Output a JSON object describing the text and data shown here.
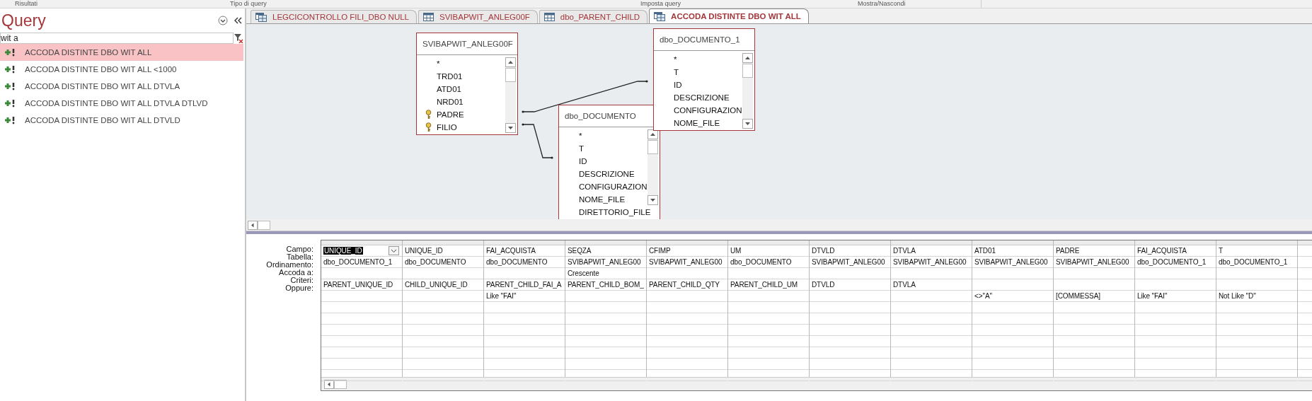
{
  "ribbon_groups": [
    "Risultati",
    "Tipo di query",
    "Imposta query",
    "Mostra/Nascondi"
  ],
  "nav_pane": {
    "title": "Query",
    "search": {
      "value": "wit a"
    },
    "items": [
      {
        "label": "ACCODA DISTINTE DBO WIT ALL",
        "selected": true
      },
      {
        "label": "ACCODA DISTINTE DBO WIT ALL <1000",
        "selected": false
      },
      {
        "label": "ACCODA DISTINTE DBO WIT ALL DTVLA",
        "selected": false
      },
      {
        "label": "ACCODA DISTINTE DBO WIT ALL DTVLA DTLVD",
        "selected": false
      },
      {
        "label": "ACCODA DISTINTE DBO WIT ALL DTVLD",
        "selected": false
      }
    ]
  },
  "tabs": [
    {
      "label": "LEGCICONTROLLO FILI_DBO NULL",
      "kind": "query",
      "selected": false
    },
    {
      "label": "SVIBAPWIT_ANLEG00F",
      "kind": "table",
      "selected": false
    },
    {
      "label": "dbo_PARENT_CHILD",
      "kind": "table",
      "selected": false
    },
    {
      "label": "ACCODA DISTINTE DBO WIT ALL",
      "kind": "query",
      "selected": true
    }
  ],
  "tables": [
    {
      "title": "SVIBAPWIT_ANLEG00F",
      "fields": [
        {
          "name": "*",
          "key": false
        },
        {
          "name": "TRD01",
          "key": false
        },
        {
          "name": "ATD01",
          "key": false
        },
        {
          "name": "NRD01",
          "key": false
        },
        {
          "name": "PADRE",
          "key": true
        },
        {
          "name": "FILIO",
          "key": true
        }
      ]
    },
    {
      "title": "dbo_DOCUMENTO",
      "fields": [
        {
          "name": "*",
          "key": false
        },
        {
          "name": "T",
          "key": false
        },
        {
          "name": "ID",
          "key": false
        },
        {
          "name": "DESCRIZIONE",
          "key": false
        },
        {
          "name": "CONFIGURAZION",
          "key": false
        },
        {
          "name": "NOME_FILE",
          "key": false
        },
        {
          "name": "DIRETTORIO_FILE",
          "key": false
        }
      ]
    },
    {
      "title": "dbo_DOCUMENTO_1",
      "fields": [
        {
          "name": "*",
          "key": false
        },
        {
          "name": "T",
          "key": false
        },
        {
          "name": "ID",
          "key": false
        },
        {
          "name": "DESCRIZIONE",
          "key": false
        },
        {
          "name": "CONFIGURAZION",
          "key": false
        },
        {
          "name": "NOME_FILE",
          "key": false
        }
      ]
    }
  ],
  "grid": {
    "row_labels": [
      "Campo:",
      "Tabella:",
      "Ordinamento:",
      "Accoda a:",
      "Criteri:",
      "Oppure:"
    ],
    "columns": [
      {
        "campo": "UNIQUE_ID",
        "tabella": "dbo_DOCUMENTO_1",
        "accoda": "PARENT_UNIQUE_ID",
        "selected": true
      },
      {
        "campo": "UNIQUE_ID",
        "tabella": "dbo_DOCUMENTO",
        "accoda": "CHILD_UNIQUE_ID",
        "selected": false
      },
      {
        "campo": "FAI_ACQUISTA",
        "tabella": "dbo_DOCUMENTO",
        "accoda": "PARENT_CHILD_FAI_A",
        "criteri": "Like \"FAI\"",
        "selected": false
      },
      {
        "campo": "SEQZA",
        "tabella": "SVIBAPWIT_ANLEG00",
        "ordinamento": "Crescente",
        "accoda": "PARENT_CHILD_BOM_",
        "selected": false
      },
      {
        "campo": "CFIMP",
        "tabella": "SVIBAPWIT_ANLEG00",
        "accoda": "PARENT_CHILD_QTY",
        "selected": false
      },
      {
        "campo": "UM",
        "tabella": "dbo_DOCUMENTO",
        "accoda": "PARENT_CHILD_UM",
        "selected": false
      },
      {
        "campo": "DTVLD",
        "tabella": "SVIBAPWIT_ANLEG00",
        "accoda": "DTVLD",
        "selected": false
      },
      {
        "campo": "DTVLA",
        "tabella": "SVIBAPWIT_ANLEG00",
        "accoda": "DTVLA",
        "selected": false
      },
      {
        "campo": "ATD01",
        "tabella": "SVIBAPWIT_ANLEG00",
        "criteri": "<>\"A\"",
        "selected": false
      },
      {
        "campo": "PADRE",
        "tabella": "SVIBAPWIT_ANLEG00",
        "criteri": "[COMMESSA]",
        "selected": false
      },
      {
        "campo": "FAI_ACQUISTA",
        "tabella": "dbo_DOCUMENTO_1",
        "criteri": "Like \"FAI\"",
        "selected": false
      },
      {
        "campo": "T",
        "tabella": "dbo_DOCUMENTO_1",
        "criteri": "Not Like \"D\"",
        "selected": false
      }
    ]
  }
}
